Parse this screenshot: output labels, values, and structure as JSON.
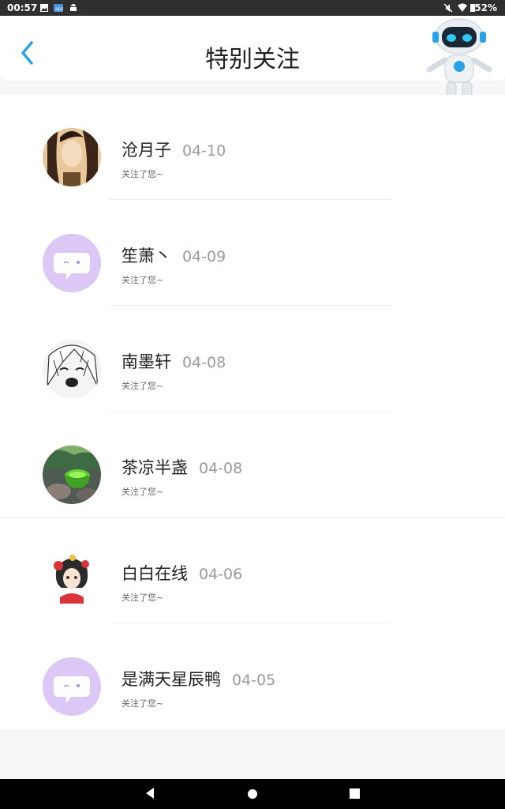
{
  "status_bar": {
    "time": "00:57",
    "battery": "52%"
  },
  "header": {
    "title": "特别关注"
  },
  "followers": [
    {
      "name": "沧月子",
      "date": "04-10",
      "subtitle": "关注了您~",
      "avatar": "painting-avatar"
    },
    {
      "name": "笙萧丶",
      "date": "04-09",
      "subtitle": "关注了您~",
      "avatar": "default-chat-avatar"
    },
    {
      "name": "南墨轩",
      "date": "04-08",
      "subtitle": "关注了您~",
      "avatar": "manga-crying-avatar"
    },
    {
      "name": "茶凉半盏",
      "date": "04-08",
      "subtitle": "关注了您~",
      "avatar": "green-tea-avatar"
    },
    {
      "name": "白白在线",
      "date": "04-06",
      "subtitle": "关注了您~",
      "avatar": "anime-girl-avatar"
    },
    {
      "name": "是满天星辰鸭",
      "date": "04-05",
      "subtitle": "关注了您~",
      "avatar": "default-chat-avatar"
    }
  ],
  "colors": {
    "accent": "#2aa2e6",
    "default_avatar": "#dcc8f7",
    "muted": "#9a9a9a"
  }
}
